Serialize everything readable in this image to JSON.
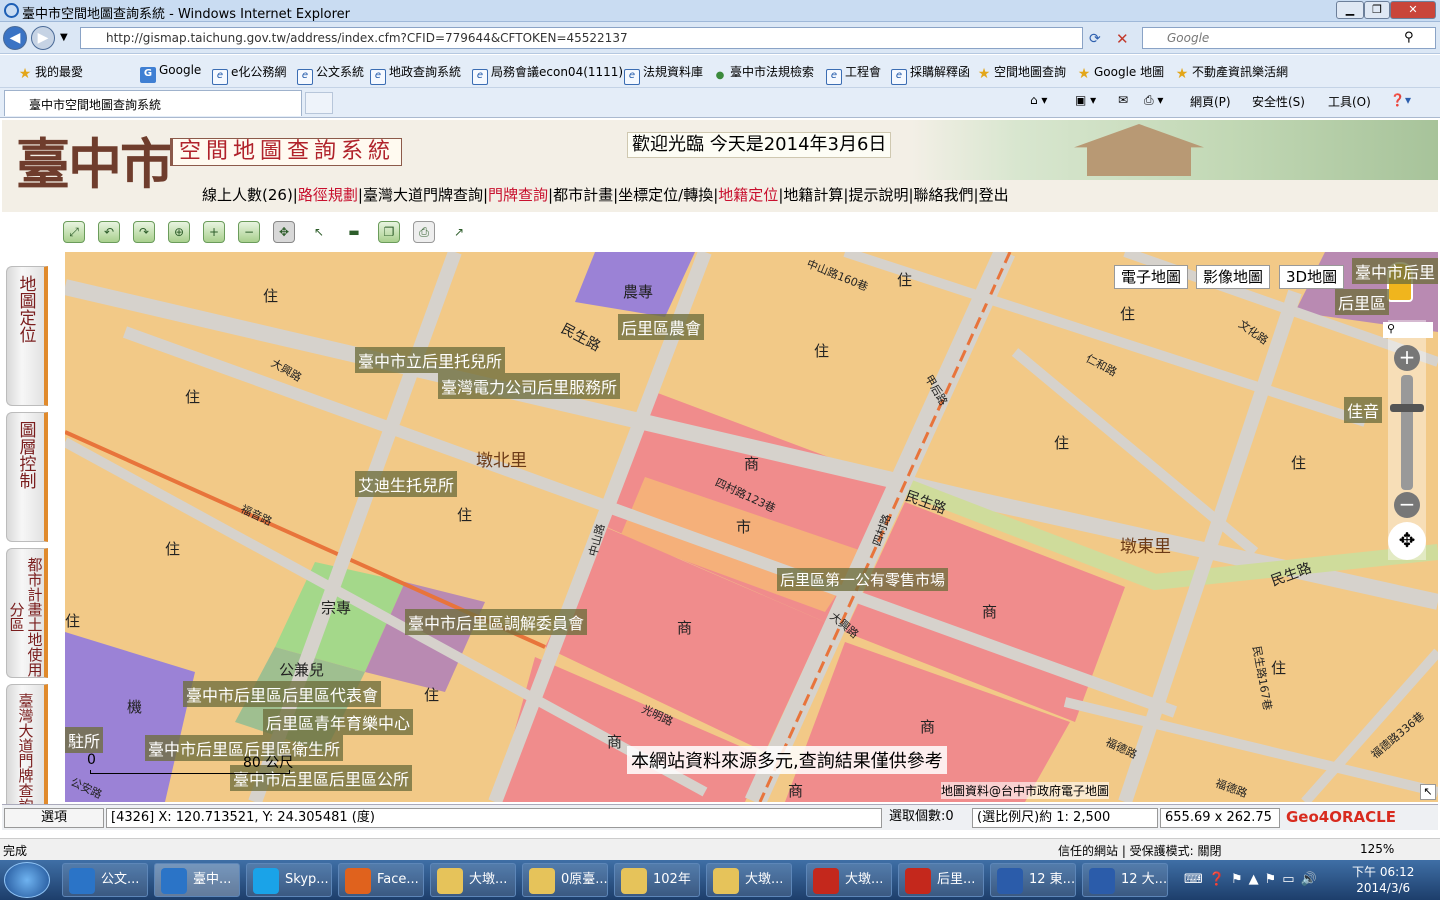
{
  "window": {
    "title": "臺中市空間地圖查詢系統 - Windows Internet Explorer"
  },
  "address": {
    "url": "http://gismap.taichung.gov.tw/address/index.cfm?CFID=779644&CFTOKEN=45522137",
    "search_placeholder": "Google"
  },
  "favorites": [
    "我的最愛",
    "Google",
    "e化公務網",
    "公文系統",
    "地政查詢系統",
    "局務會議econ04(1111)",
    "法規資料庫",
    "臺中市法規檢索",
    "工程會",
    "採購解釋函",
    "空間地圖查詢",
    "Google 地圖",
    "不動產資訊樂活網"
  ],
  "tab": {
    "title": "臺中市空間地圖查詢系統"
  },
  "commandbar": {
    "page": "網頁(P)",
    "safety": "安全性(S)",
    "tools": "工具(O)"
  },
  "header": {
    "logo": "臺中市",
    "subtitle": "空間地圖查詢系統",
    "welcome": "歡迎光臨 今天是2014年3月6日",
    "menu": [
      {
        "label": "線上人數(26)",
        "color": "normal"
      },
      {
        "label": "路徑規劃",
        "color": "red"
      },
      {
        "label": "臺灣大道門牌查詢",
        "color": "normal"
      },
      {
        "label": "門牌查詢",
        "color": "red"
      },
      {
        "label": "都市計畫",
        "color": "normal"
      },
      {
        "label": "坐標定位/轉換",
        "color": "normal"
      },
      {
        "label": "地籍定位",
        "color": "red"
      },
      {
        "label": "地籍計算",
        "color": "normal"
      },
      {
        "label": "提示說明",
        "color": "normal"
      },
      {
        "label": "聯絡我們",
        "color": "normal"
      },
      {
        "label": "登出",
        "color": "normal"
      }
    ]
  },
  "sidebar": [
    "地圖定位",
    "圖層控制",
    "都市計畫土地使用分區",
    "臺灣大道門牌查詢"
  ],
  "map": {
    "buttons": [
      "電子地圖",
      "影像地圖",
      "3D地圖"
    ],
    "poi": [
      "臺中市立后里托兒所",
      "臺灣電力公司后里服務所",
      "后里區農會",
      "艾迪生托兒所",
      "后里區第一公有零售市場",
      "臺中市后里區調解委員會",
      "臺中市后里區后里區代表會",
      "后里區青年育樂中心",
      "臺中市后里區后里區衛生所",
      "臺中市后里區后里區公所",
      "臺中市后里",
      "后里區",
      "佳音",
      "駐所"
    ],
    "villages": [
      "墩北里",
      "墩東里"
    ],
    "zones": [
      "住",
      "商",
      "市",
      "農專",
      "宗專",
      "公兼兒",
      "機"
    ],
    "roads": [
      "民生路",
      "大興路",
      "中山路160巷",
      "仁和路",
      "甲后路",
      "文化路",
      "福音路",
      "四村路123巷",
      "四村路",
      "民生路167巷",
      "福德路",
      "福德路336巷",
      "中山路",
      "公安路",
      "光明路"
    ],
    "scale": {
      "zero": "0",
      "distance": "80 公尺"
    },
    "disclaimer": "本網站資料來源多元,查詢結果僅供參考",
    "credit": "地圖資料@台中市政府電子地圖"
  },
  "status": {
    "options": "選項",
    "coords": "[4326] X: 120.713521, Y: 24.305481 (度)",
    "selected": "選取個數:0",
    "scale": "(選比例尺)約 1: 2,500",
    "size": "655.69 x 262.75 (m",
    "brand": "Geo4ORACLE"
  },
  "ie_status": {
    "done": "完成",
    "zone": "信任的網站 | 受保護模式: 關閉",
    "zoom": "125%"
  },
  "taskbar": {
    "items": [
      "公文...",
      "臺中...",
      "Skyp...",
      "Face...",
      "大墩...",
      "0原臺...",
      "102年",
      "大墩...",
      "大墩...",
      "后里...",
      "12 東...",
      "12 大..."
    ],
    "time": "下午 06:12",
    "date": "2014/3/6"
  },
  "colors": {
    "residential": "#f2c987",
    "commercial": "#f08c8c",
    "market": "#f5b07a",
    "agri": "#9b82d6",
    "religious": "#a4d88a",
    "school": "#b98ab2",
    "road": "#d6d2cc",
    "rail": "#e8743b"
  }
}
